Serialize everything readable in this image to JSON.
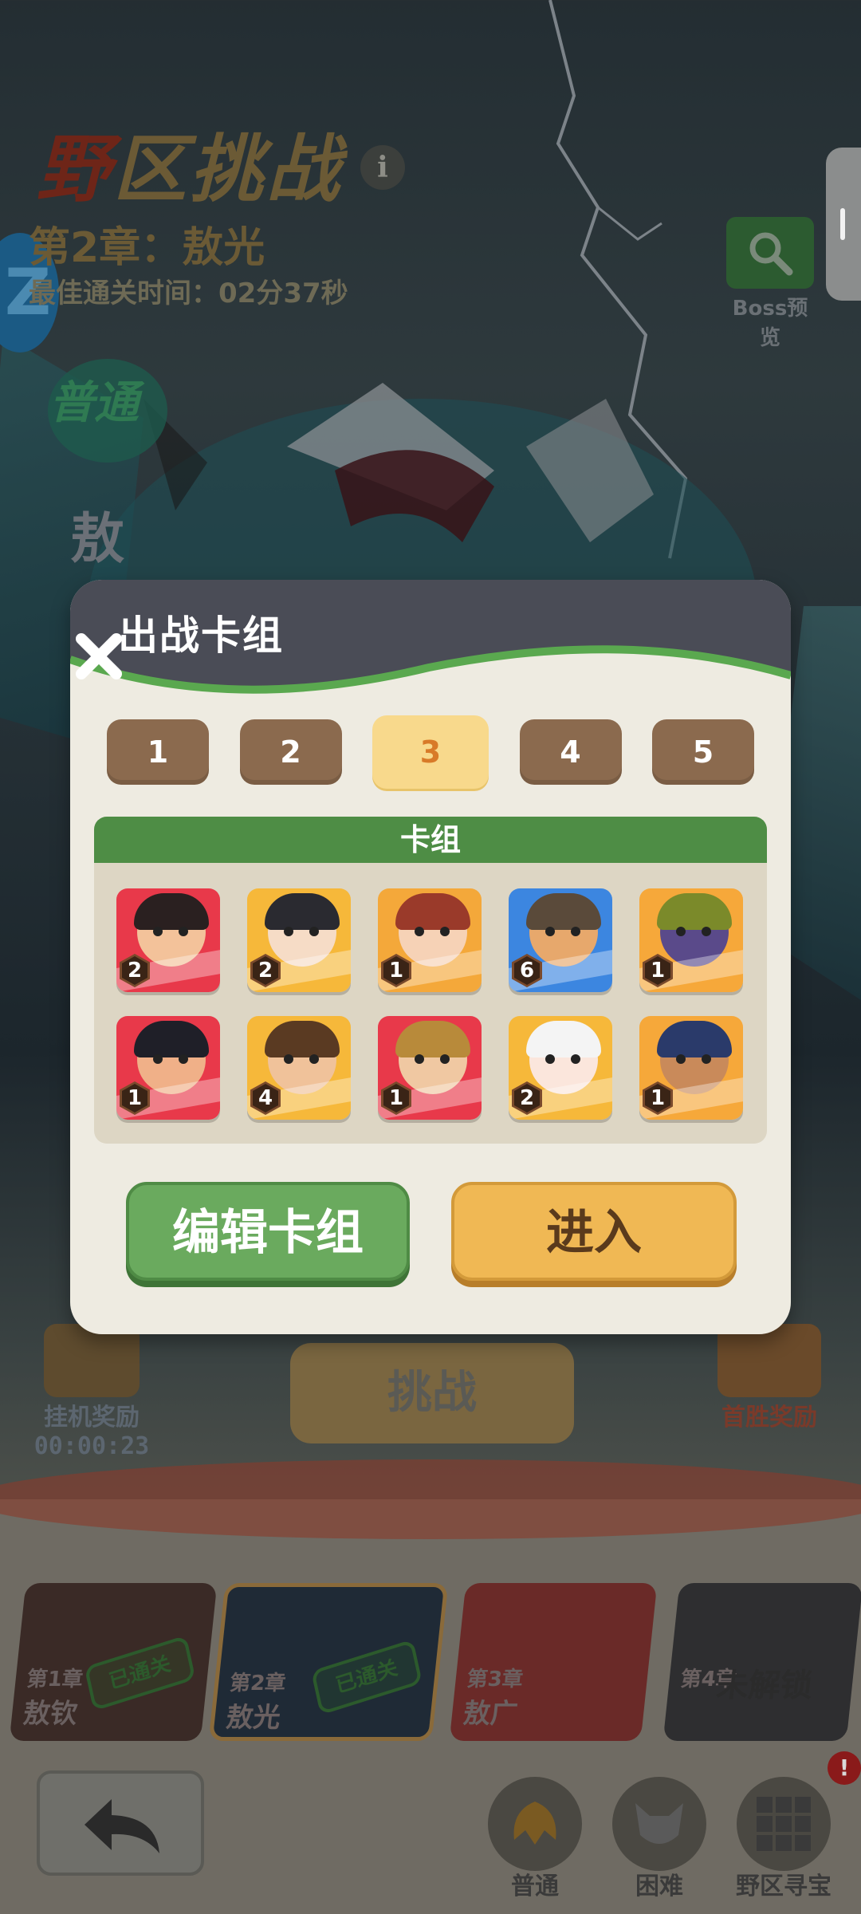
{
  "header": {
    "title_first_char": "野",
    "title_rest": "区挑战",
    "info_icon": "i",
    "chapter": "第2章：敖光",
    "best_time": "最佳通关时间：02分37秒",
    "z_badge": "Z",
    "mode_label": "普通",
    "vertical_name": "敖"
  },
  "boss_preview": {
    "label": "Boss预览",
    "icon": "magnifier-icon"
  },
  "modal": {
    "title": "出战卡组",
    "close_icon": "close-icon",
    "deck_tabs": [
      {
        "label": "1",
        "active": false
      },
      {
        "label": "2",
        "active": false
      },
      {
        "label": "3",
        "active": true
      },
      {
        "label": "4",
        "active": false
      },
      {
        "label": "5",
        "active": false
      }
    ],
    "panel_title": "卡组",
    "cards": [
      {
        "level": "2",
        "bg": "#e8394a",
        "hair": "#2a2020",
        "skin": "#f3c29a"
      },
      {
        "level": "2",
        "bg": "#f6b83a",
        "hair": "#2a2a30",
        "skin": "#f6dcc6"
      },
      {
        "level": "1",
        "bg": "#f4a83a",
        "hair": "#9a3a2a",
        "skin": "#f6d2b6"
      },
      {
        "level": "6",
        "bg": "#3c86e0",
        "hair": "#5a4a3a",
        "skin": "#e7a86c"
      },
      {
        "level": "1",
        "bg": "#f6a83a",
        "hair": "#7b8a2a",
        "skin": "#5a4a8a"
      },
      {
        "level": "1",
        "bg": "#e8394a",
        "hair": "#1f1f28",
        "skin": "#f0b088"
      },
      {
        "level": "4",
        "bg": "#f6b83a",
        "hair": "#5a3a22",
        "skin": "#f0c29a"
      },
      {
        "level": "1",
        "bg": "#e8394a",
        "hair": "#b88a3a",
        "skin": "#f0c8a2"
      },
      {
        "level": "2",
        "bg": "#f6b83a",
        "hair": "#f4f4f4",
        "skin": "#fbe6dc"
      },
      {
        "level": "1",
        "bg": "#f6a83a",
        "hair": "#2a3a6a",
        "skin": "#c98a5a"
      }
    ],
    "edit_button": "编辑卡组",
    "enter_button": "进入"
  },
  "idle_reward": {
    "label": "挂机奖励",
    "time": "00:00:23"
  },
  "challenge_button": "挑战",
  "first_reward": {
    "label": "首胜奖励"
  },
  "chapters": [
    {
      "num": "第1章",
      "name": "敖钦",
      "status": "已通关"
    },
    {
      "num": "第2章",
      "name": "敖光",
      "status": "已通关"
    },
    {
      "num": "第3章",
      "name": "敖广",
      "status": ""
    },
    {
      "num": "第4章",
      "name": "",
      "status": "未解锁"
    }
  ],
  "bottom_nav": [
    {
      "label": "普通",
      "icon": "dragon-gold-icon"
    },
    {
      "label": "困难",
      "icon": "demon-mask-icon"
    },
    {
      "label": "野区寻宝",
      "icon": "grid-icon"
    }
  ],
  "notification": "!"
}
